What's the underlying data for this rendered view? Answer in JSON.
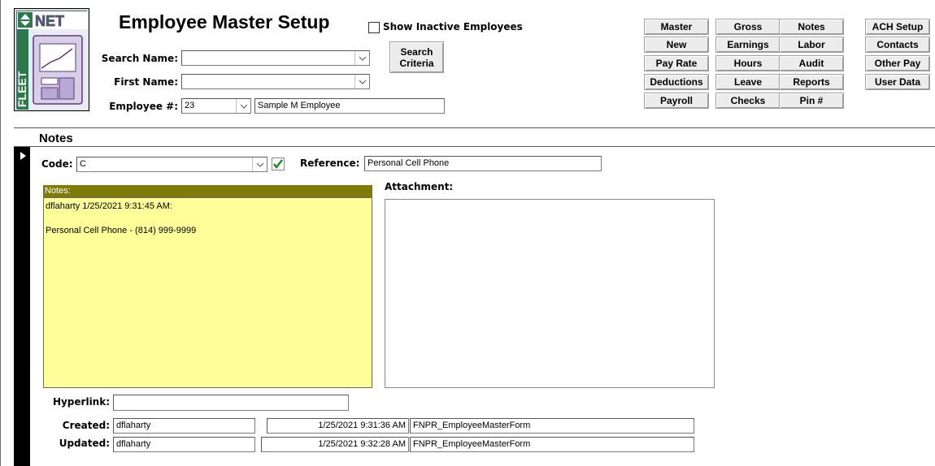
{
  "header": {
    "title": "Employee Master Setup",
    "show_inactive_label": "Show Inactive Employees",
    "search_name_label": "Search Name:",
    "search_name_value": "",
    "first_name_label": "First Name:",
    "first_name_value": "",
    "employee_num_label": "Employee #:",
    "employee_num_value": "23",
    "employee_name_value": "Sample M Employee",
    "search_criteria_line1": "Search",
    "search_criteria_line2": "Criteria"
  },
  "toolbar": [
    [
      "Master",
      "Gross",
      "Notes",
      "ACH Setup"
    ],
    [
      "New",
      "Earnings",
      "Labor",
      "Contacts"
    ],
    [
      "Pay Rate",
      "Hours",
      "Audit",
      "Other Pay"
    ],
    [
      "Deductions",
      "Leave",
      "Reports",
      "User Data"
    ],
    [
      "Payroll",
      "Checks",
      "Pin #"
    ]
  ],
  "notes": {
    "section_title": "Notes",
    "code_label": "Code:",
    "code_value": "C",
    "reference_label": "Reference:",
    "reference_value": "Personal Cell Phone",
    "notes_header": "Notes:",
    "notes_line1": "dflaharty 1/25/2021 9:31:45 AM:",
    "notes_line2": "",
    "notes_line3": "Personal Cell Phone - (814) 999-9999",
    "attachment_label": "Attachment:",
    "hyperlink_label": "Hyperlink:",
    "hyperlink_value": "",
    "created_label": "Created:",
    "created_user": "dflaharty",
    "created_time": "1/25/2021 9:31:36 AM",
    "created_form": "FNPR_EmployeeMasterForm",
    "updated_label": "Updated:",
    "updated_user": "dflaharty",
    "updated_time": "1/25/2021 9:32:28 AM",
    "updated_form": "FNPR_EmployeeMasterForm"
  },
  "colors": {
    "notes_header_bg": "#7e7b09",
    "notes_bg": "#ffff99",
    "logo_green": "#4a8a5a",
    "logo_purple": "#6a4a8a"
  },
  "logo": {
    "top_text": "NET",
    "side_text": "FLEET"
  }
}
